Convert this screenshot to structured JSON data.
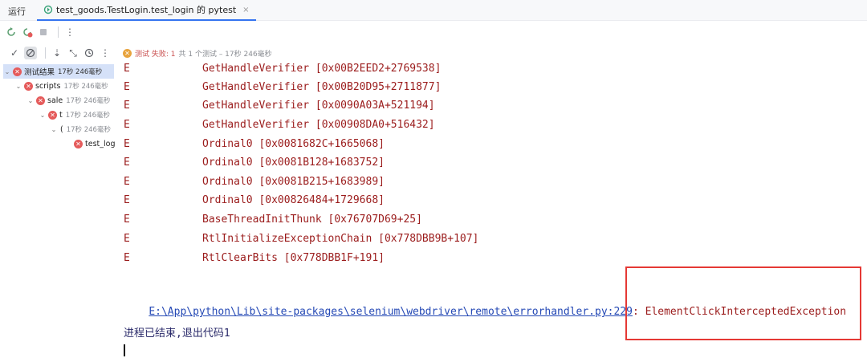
{
  "tabbar": {
    "panel_title": "运行",
    "run_tab_label": "test_goods.TestLogin.test_login 的 pytest",
    "close_glyph": "×"
  },
  "toolbar1": {
    "icons": [
      "rerun-icon",
      "rerun-failed-icon",
      "stop-icon",
      "more-icon"
    ]
  },
  "toolbar2": {
    "icons": [
      "show-passed-icon",
      "show-ignored-icon",
      "sort-icon",
      "collapse-icon",
      "history-icon",
      "more-icon"
    ],
    "status": {
      "prefix": "测试",
      "failed_label": "失败: 1",
      "summary": "共 1 个测试 – 17秒 246毫秒"
    }
  },
  "tree": [
    {
      "name": "测试结果",
      "time": "17秒 246毫秒",
      "level": 0,
      "selected": true
    },
    {
      "name": "scripts",
      "time": "17秒 246毫秒",
      "level": 1
    },
    {
      "name": "sale",
      "time": "17秒 246毫秒",
      "level": 2
    },
    {
      "name": "t",
      "time": "17秒 246毫秒",
      "level": 3
    },
    {
      "name": "(",
      "time": "17秒 246毫秒",
      "level": 4
    },
    {
      "name": "test_log",
      "time": "",
      "level": 5
    }
  ],
  "console": {
    "lines": [
      {
        "prefix": "E",
        "text": "GetHandleVerifier [0x00B2EED2+2769538]"
      },
      {
        "prefix": "E",
        "text": "GetHandleVerifier [0x00B20D95+2711877]"
      },
      {
        "prefix": "E",
        "text": "GetHandleVerifier [0x0090A03A+521194]"
      },
      {
        "prefix": "E",
        "text": "GetHandleVerifier [0x00908DA0+516432]"
      },
      {
        "prefix": "E",
        "text": "Ordinal0 [0x0081682C+1665068]"
      },
      {
        "prefix": "E",
        "text": "Ordinal0 [0x0081B128+1683752]"
      },
      {
        "prefix": "E",
        "text": "Ordinal0 [0x0081B215+1683989]"
      },
      {
        "prefix": "E",
        "text": "Ordinal0 [0x00826484+1729668]"
      },
      {
        "prefix": "E",
        "text": "BaseThreadInitThunk [0x76707D69+25]"
      },
      {
        "prefix": "E",
        "text": "RtlInitializeExceptionChain [0x778DBB9B+107]"
      },
      {
        "prefix": "E",
        "text": "RtlClearBits [0x778DBB1F+191]"
      }
    ],
    "error_link": "E:\\App\\python\\Lib\\site-packages\\selenium\\webdriver\\remote\\errorhandler.py:229",
    "error_text": ": ElementClickInterceptedException",
    "exit_message": "进程已结束,退出代码1"
  },
  "colors": {
    "error_text": "#9b1c1c",
    "link": "#2549b5",
    "annotation": "#e53935",
    "selection": "#d5e1f8"
  }
}
